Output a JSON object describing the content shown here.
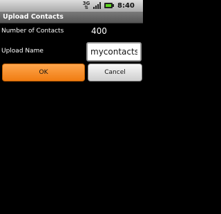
{
  "status_bar": {
    "network_label": "3G",
    "time": "8:40 AM",
    "icons": [
      "network-3g-icon",
      "signal-icon",
      "battery-icon"
    ]
  },
  "title_bar": {
    "title": "Upload Contacts"
  },
  "form": {
    "contacts_label": "Number of Contacts",
    "contacts_count": "400",
    "upload_name_label": "Upload Name",
    "upload_name_value": "mycontacts"
  },
  "buttons": {
    "ok_label": "OK",
    "cancel_label": "Cancel"
  },
  "colors": {
    "background": "#000000",
    "ok_button": "#f58a1f",
    "cancel_button": "#e0e0e0",
    "title_bar": "#666666",
    "status_bar": "#c0c0c0"
  }
}
